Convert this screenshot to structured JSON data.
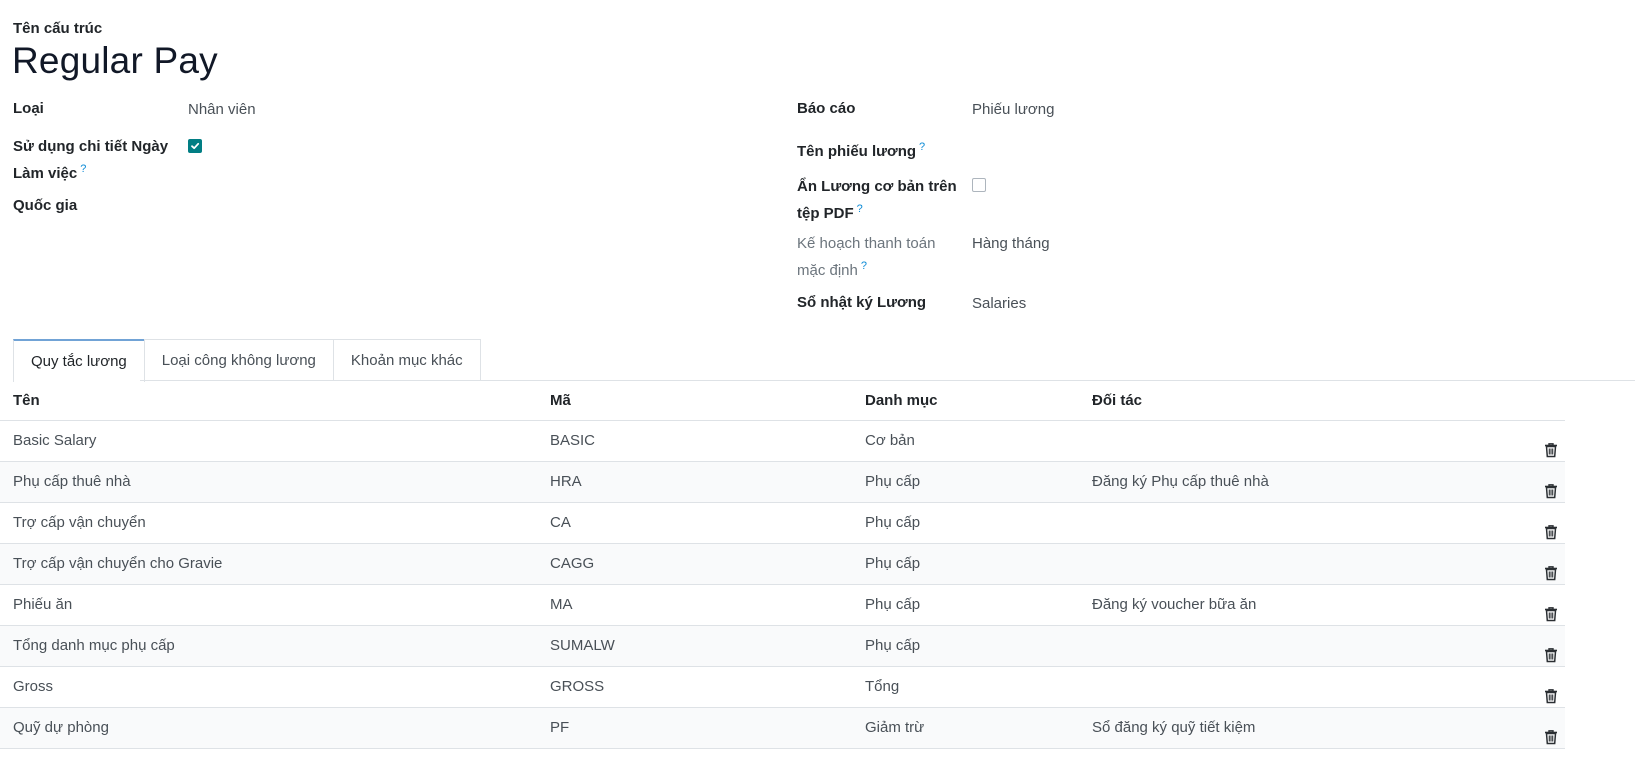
{
  "form": {
    "title_label": "Tên cấu trúc",
    "title": "Regular Pay"
  },
  "left_fields": {
    "type_label": "Loại",
    "type_value": "Nhân viên",
    "worked_days_label_line1": "Sử dụng chi tiết Ngày",
    "worked_days_label_line2": "Làm việc",
    "worked_days_checked": true,
    "country_label": "Quốc gia",
    "country_value": ""
  },
  "right_fields": {
    "report_label": "Báo cáo",
    "report_value": "Phiếu lương",
    "payslip_name_label": "Tên phiếu lương",
    "payslip_name_value": "",
    "hide_basic_label_line1": "Ẩn Lương cơ bản trên",
    "hide_basic_label_line2": "tệp PDF",
    "hide_basic_checked": false,
    "schedule_label_line1": "Kế hoạch thanh toán",
    "schedule_label_line2": "mặc định",
    "schedule_value": "Hàng tháng",
    "journal_label": "Sổ nhật ký Lương",
    "journal_value": "Salaries"
  },
  "tooltip_marker": "?",
  "tabs": [
    {
      "label": "Quy tắc lương",
      "active": true
    },
    {
      "label": "Loại công không lương",
      "active": false
    },
    {
      "label": "Khoản mục khác",
      "active": false
    }
  ],
  "table": {
    "headers": {
      "name": "Tên",
      "code": "Mã",
      "category": "Danh mục",
      "partner": "Đối tác"
    },
    "rows": [
      {
        "name": "Basic Salary",
        "code": "BASIC",
        "category": "Cơ bản",
        "partner": ""
      },
      {
        "name": "Phụ cấp thuê nhà",
        "code": "HRA",
        "category": "Phụ cấp",
        "partner": "Đăng ký Phụ cấp thuê nhà"
      },
      {
        "name": "Trợ cấp vận chuyển",
        "code": "CA",
        "category": "Phụ cấp",
        "partner": ""
      },
      {
        "name": "Trợ cấp vận chuyển cho Gravie",
        "code": "CAGG",
        "category": "Phụ cấp",
        "partner": ""
      },
      {
        "name": "Phiếu ăn",
        "code": "MA",
        "category": "Phụ cấp",
        "partner": "Đăng ký voucher bữa ăn"
      },
      {
        "name": "Tổng danh mục phụ cấp",
        "code": "SUMALW",
        "category": "Phụ cấp",
        "partner": ""
      },
      {
        "name": "Gross",
        "code": "GROSS",
        "category": "Tổng",
        "partner": ""
      },
      {
        "name": "Quỹ dự phòng",
        "code": "PF",
        "category": "Giảm trừ",
        "partner": "Sổ đăng ký quỹ tiết kiệm"
      }
    ]
  },
  "colors": {
    "checkbox_accent": "#017e84",
    "tooltip": "#0d8bd6",
    "active_tab_border": "#71a3d6"
  },
  "icons": {
    "row_delete": "trash-icon",
    "checkbox_check": "check-icon"
  }
}
